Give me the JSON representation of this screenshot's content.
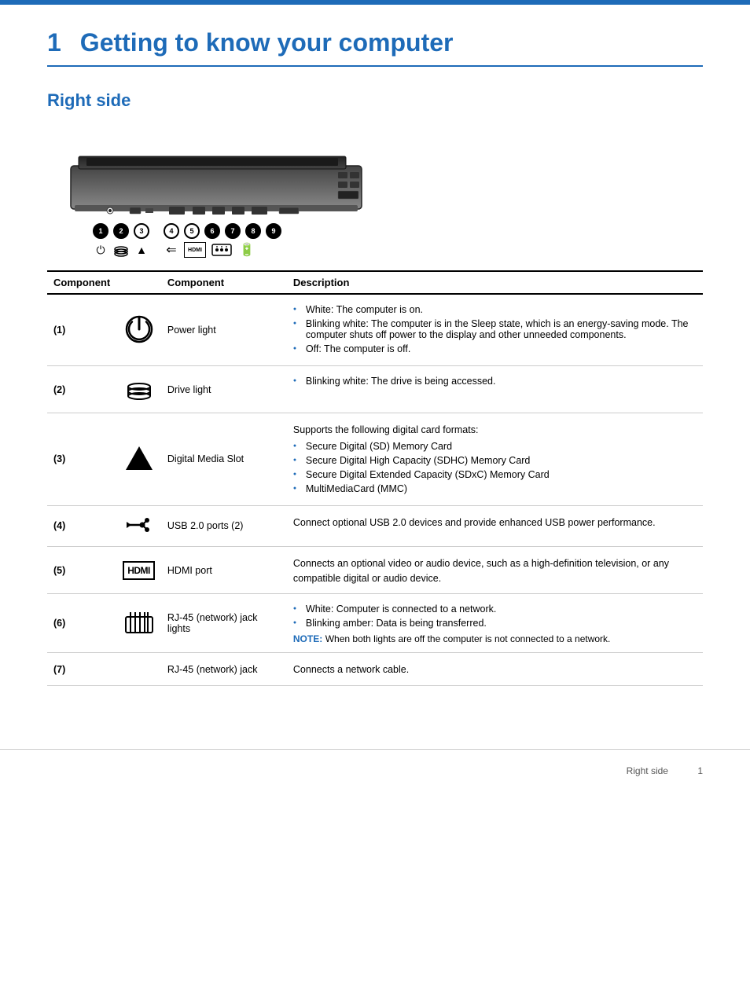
{
  "top_bar": {},
  "chapter": {
    "number": "1",
    "title": "Getting to know your computer"
  },
  "section": {
    "title": "Right side"
  },
  "table": {
    "col_component": "Component",
    "col_description": "Description",
    "rows": [
      {
        "num": "(1)",
        "icon_name": "power-icon",
        "name": "Power light",
        "desc_type": "bullets",
        "bullets": [
          "White: The computer is on.",
          "Blinking white: The computer is in the Sleep state, which is an energy-saving mode. The computer shuts off power to the display and other unneeded components.",
          "Off: The computer is off."
        ],
        "note": null
      },
      {
        "num": "(2)",
        "icon_name": "drive-icon",
        "name": "Drive light",
        "desc_type": "bullets",
        "bullets": [
          "Blinking white: The drive is being accessed."
        ],
        "note": null
      },
      {
        "num": "(3)",
        "icon_name": "card-icon",
        "name": "Digital Media Slot",
        "desc_type": "mixed",
        "plain": "Supports the following digital card formats:",
        "bullets": [
          "Secure Digital (SD) Memory Card",
          "Secure Digital High Capacity (SDHC) Memory Card",
          "Secure Digital Extended Capacity (SDxC) Memory Card",
          "MultiMediaCard (MMC)"
        ],
        "note": null
      },
      {
        "num": "(4)",
        "icon_name": "usb-icon",
        "name": "USB 2.0 ports (2)",
        "desc_type": "plain",
        "plain": "Connect optional USB 2.0 devices and provide enhanced USB power performance.",
        "bullets": [],
        "note": null
      },
      {
        "num": "(5)",
        "icon_name": "hdmi-icon",
        "name": "HDMI port",
        "desc_type": "plain",
        "plain": "Connects an optional video or audio device, such as a high-definition television, or any compatible digital or audio device.",
        "bullets": [],
        "note": null
      },
      {
        "num": "(6)",
        "icon_name": "network-lights-icon",
        "name": "RJ-45 (network) jack lights",
        "desc_type": "bullets_note",
        "bullets": [
          "White: Computer is connected to a network.",
          "Blinking amber: Data is being transferred."
        ],
        "note_label": "NOTE:",
        "note_text": "When both lights are off the computer is not connected to a network."
      },
      {
        "num": "(7)",
        "icon_name": "network-jack-icon",
        "name": "RJ-45 (network) jack",
        "desc_type": "plain",
        "plain": "Connects a network cable.",
        "bullets": [],
        "note": null
      }
    ]
  },
  "footer": {
    "text": "Right side",
    "page": "1"
  }
}
